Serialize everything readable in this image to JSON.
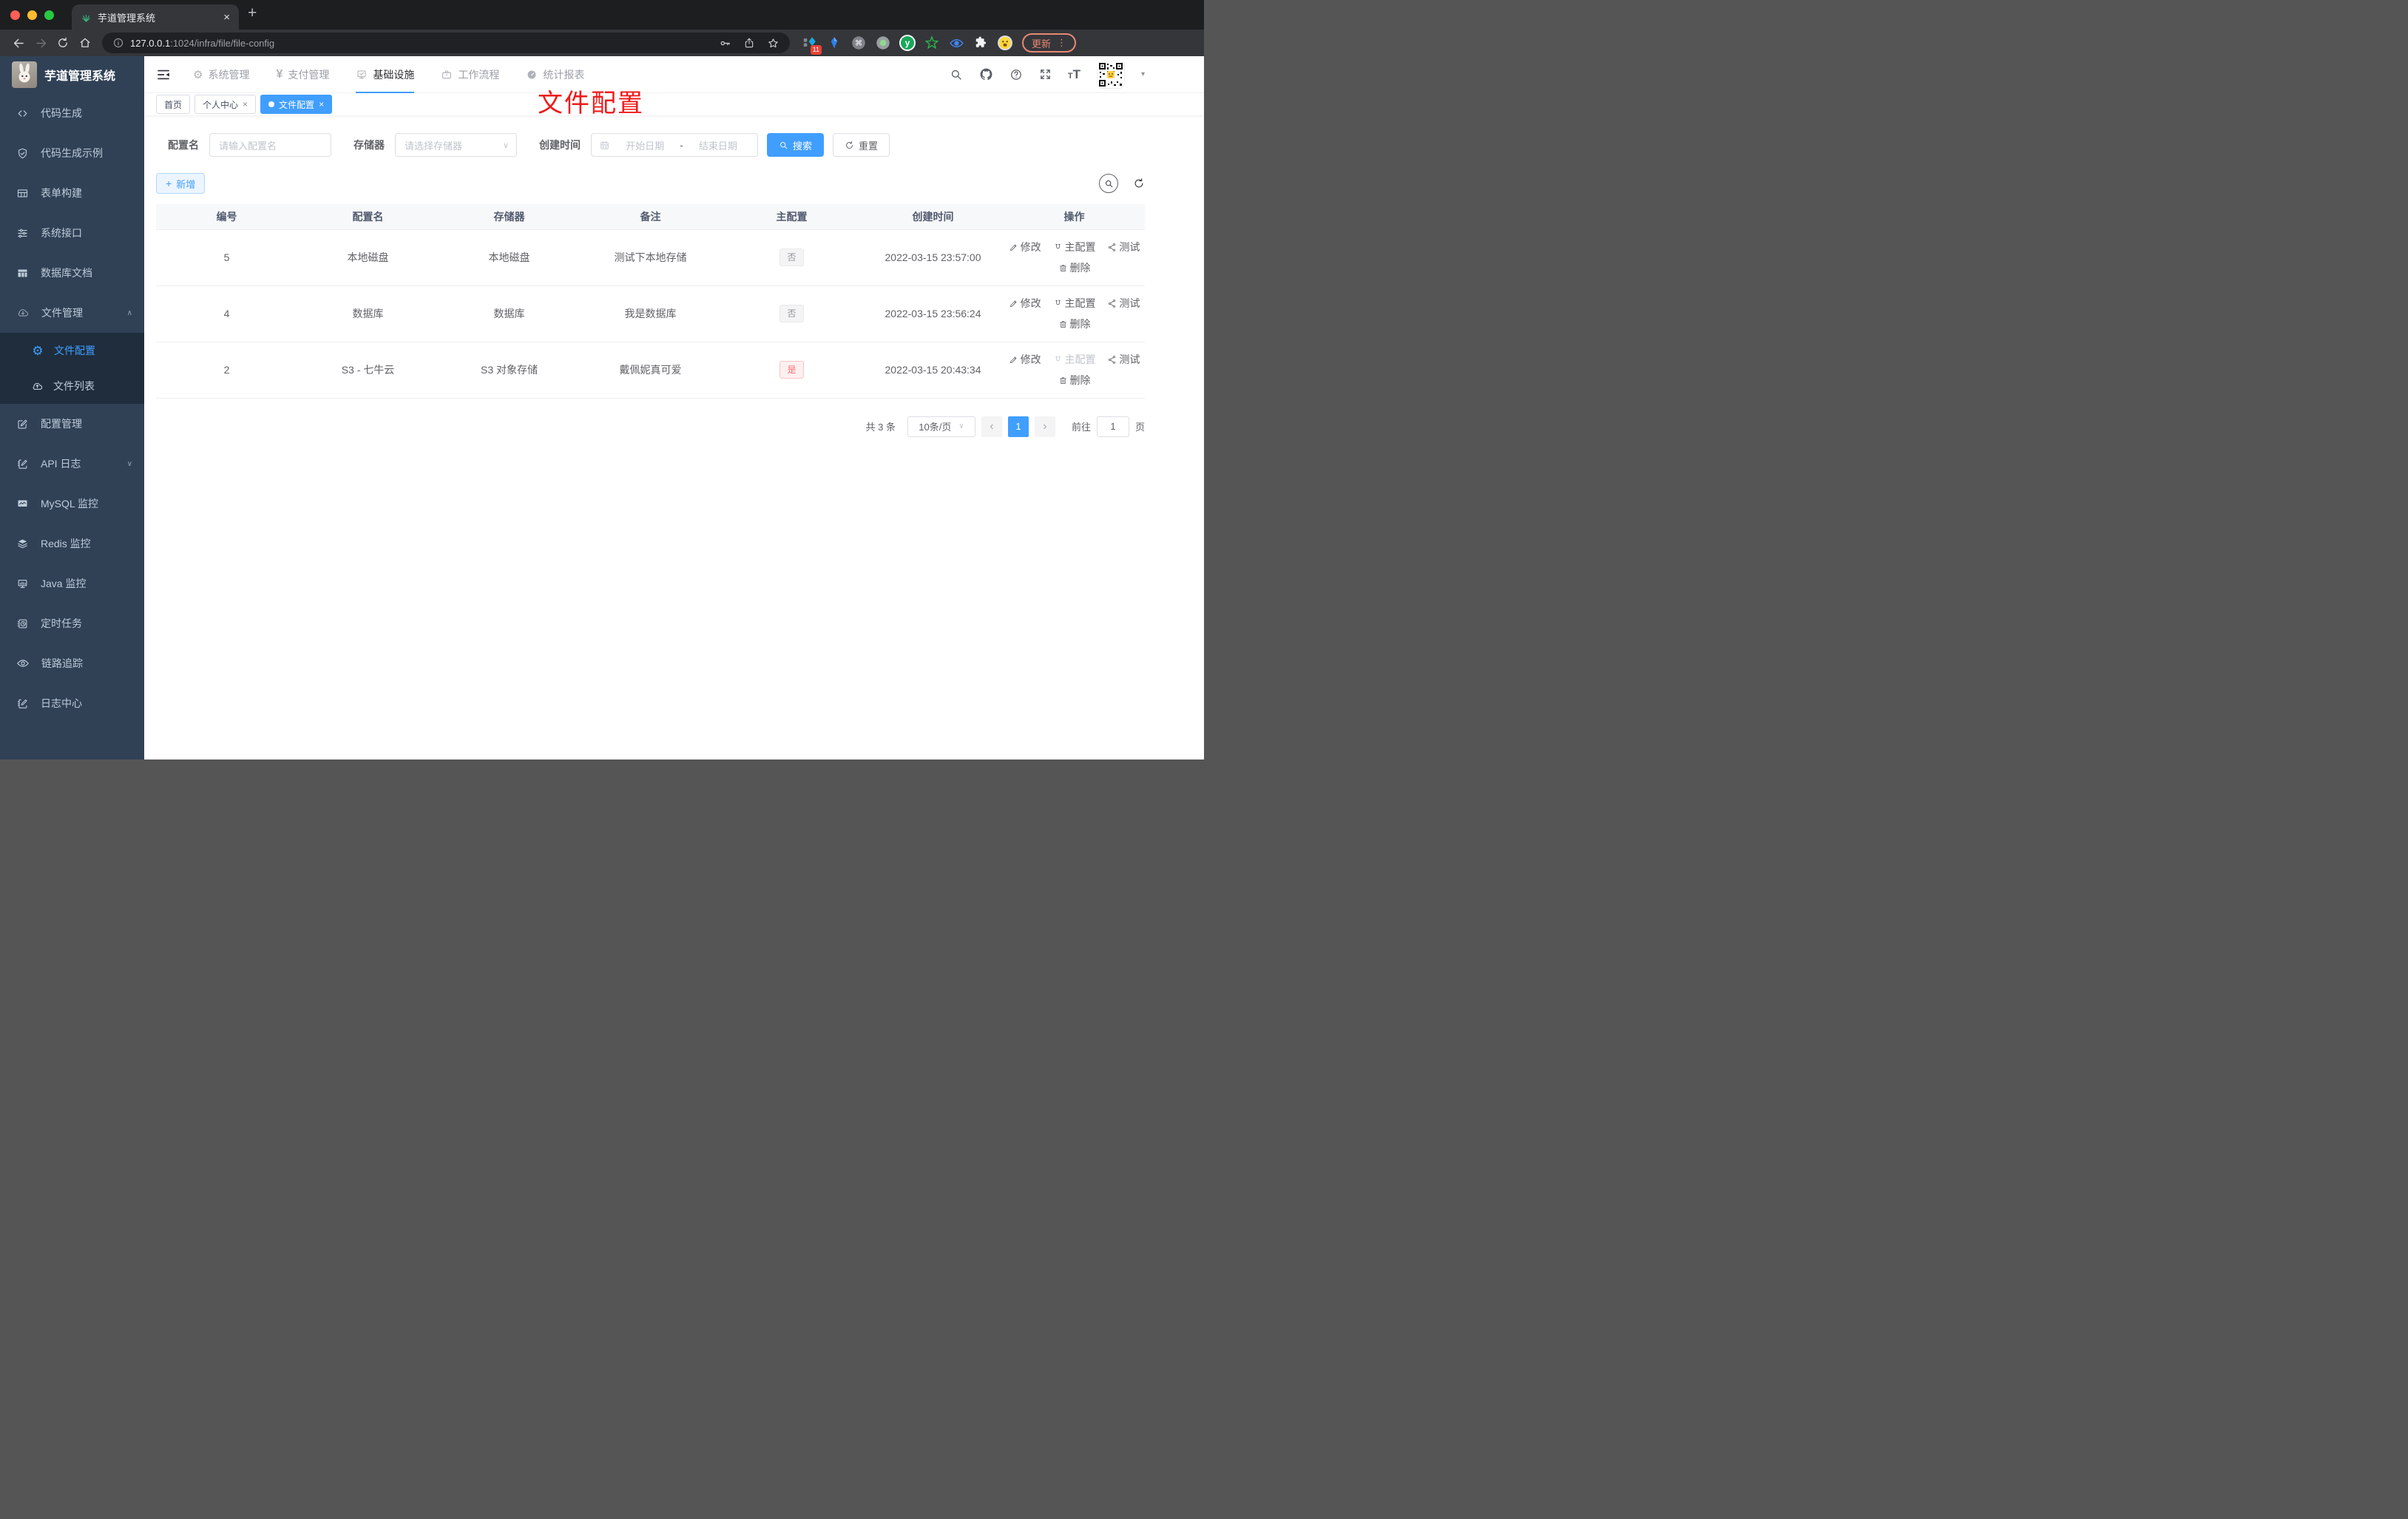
{
  "browser": {
    "tab_title": "芋道管理系统",
    "url_host": "127.0.0.1",
    "url_rest": ":1024/infra/file/file-config",
    "update_label": "更新",
    "ext_badge": "11"
  },
  "glyphs": {
    "close": "×",
    "plus": "+",
    "kebab": "⋮",
    "caret": "▾",
    "chevron_down": "∨",
    "chevron_up": "∧",
    "dot": "●",
    "prev": "‹",
    "next": "›",
    "dash": "-",
    "yen": "¥",
    "gear": "⚙",
    "cmd": "⌘",
    "y_letter": "y",
    "t_small": "T",
    "t_big": "T"
  },
  "header": {
    "nav": [
      {
        "label": "系统管理"
      },
      {
        "label": "支付管理"
      },
      {
        "label": "基础设施"
      },
      {
        "label": "工作流程"
      },
      {
        "label": "统计报表"
      }
    ]
  },
  "tags": [
    {
      "label": "首页"
    },
    {
      "label": "个人中心"
    },
    {
      "label": "文件配置"
    }
  ],
  "overlay_title": "文件配置",
  "sidebar": {
    "title": "芋道管理系统",
    "items": [
      {
        "label": "代码生成"
      },
      {
        "label": "代码生成示例"
      },
      {
        "label": "表单构建"
      },
      {
        "label": "系统接口"
      },
      {
        "label": "数据库文档"
      },
      {
        "label": "文件管理"
      },
      {
        "label": "文件配置"
      },
      {
        "label": "文件列表"
      },
      {
        "label": "配置管理"
      },
      {
        "label": "API 日志"
      },
      {
        "label": "MySQL 监控"
      },
      {
        "label": "Redis 监控"
      },
      {
        "label": "Java 监控"
      },
      {
        "label": "定时任务"
      },
      {
        "label": "链路追踪"
      },
      {
        "label": "日志中心"
      }
    ]
  },
  "filters": {
    "name_label": "配置名",
    "name_placeholder": "请输入配置名",
    "storage_label": "存储器",
    "storage_placeholder": "请选择存储器",
    "time_label": "创建时间",
    "start_placeholder": "开始日期",
    "separator": "-",
    "end_placeholder": "结束日期",
    "search_label": "搜索",
    "reset_label": "重置"
  },
  "toolbar": {
    "add_label": "新增"
  },
  "table": {
    "columns": [
      "编号",
      "配置名",
      "存储器",
      "备注",
      "主配置",
      "创建时间",
      "操作"
    ],
    "actions": {
      "edit": "修改",
      "master": "主配置",
      "test": "测试",
      "remove": "删除"
    },
    "rows": [
      {
        "id": "5",
        "name": "本地磁盘",
        "storage": "本地磁盘",
        "remark": "测试下本地存储",
        "master": "否",
        "master_type": "info",
        "created": "2022-03-15 23:57:00",
        "master_action_disabled": false
      },
      {
        "id": "4",
        "name": "数据库",
        "storage": "数据库",
        "remark": "我是数据库",
        "master": "否",
        "master_type": "info",
        "created": "2022-03-15 23:56:24",
        "master_action_disabled": false
      },
      {
        "id": "2",
        "name": "S3 - 七牛云",
        "storage": "S3 对象存储",
        "remark": "戴佩妮真可爱",
        "master": "是",
        "master_type": "danger",
        "created": "2022-03-15 20:43:34",
        "master_action_disabled": true
      }
    ]
  },
  "pagination": {
    "total": "共 3 条",
    "size": "10条/页",
    "page": "1",
    "goto_label": "前往",
    "goto_value": "1",
    "unit_label": "页"
  }
}
